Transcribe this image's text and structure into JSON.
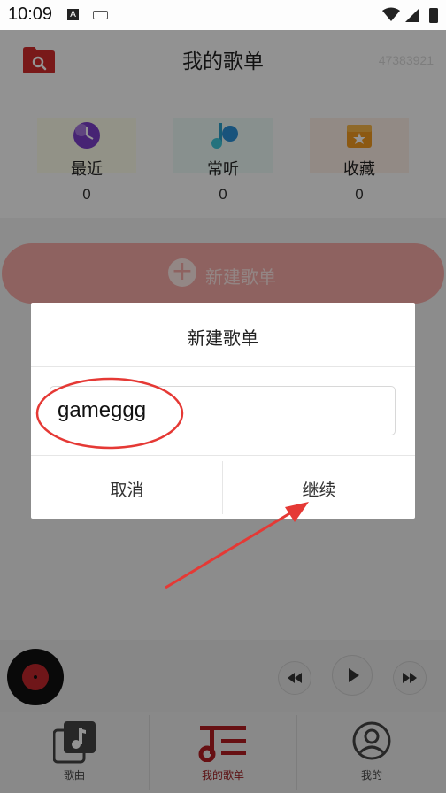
{
  "status_bar": {
    "time": "10:09"
  },
  "header": {
    "title": "我的歌单",
    "user_id": "47383921"
  },
  "stats": [
    {
      "label": "最近",
      "count": "0"
    },
    {
      "label": "常听",
      "count": "0"
    },
    {
      "label": "收藏",
      "count": "0"
    }
  ],
  "create_button": {
    "label": "新建歌单"
  },
  "dialog": {
    "title": "新建歌单",
    "input_value": "gameggg",
    "cancel_label": "取消",
    "continue_label": "继续"
  },
  "bottom_nav": [
    {
      "label": "歌曲"
    },
    {
      "label": "我的歌单"
    },
    {
      "label": "我的"
    }
  ],
  "colors": {
    "accent": "#c0262b",
    "annotation": "#e53935"
  }
}
